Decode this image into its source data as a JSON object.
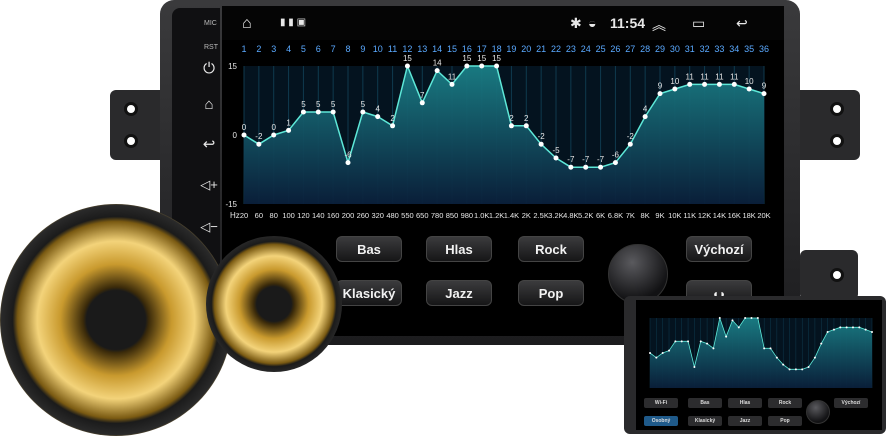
{
  "side_panel": {
    "mic_label": "MIC",
    "rst_label": "RST",
    "icons": [
      "power-icon",
      "home-icon",
      "back-icon",
      "volume-up-icon",
      "volume-down-icon"
    ]
  },
  "status_bar": {
    "time": "11:54",
    "icons": [
      "home-outline-icon",
      "notification-icons",
      "bluetooth-icon",
      "wifi-icon",
      "expand-icon",
      "recent-apps-icon",
      "back-icon"
    ]
  },
  "equalizer": {
    "band_numbers": [
      "1",
      "2",
      "3",
      "4",
      "5",
      "6",
      "7",
      "8",
      "9",
      "10",
      "11",
      "12",
      "13",
      "14",
      "15",
      "16",
      "17",
      "18",
      "19",
      "20",
      "21",
      "22",
      "23",
      "24",
      "25",
      "26",
      "27",
      "28",
      "29",
      "30",
      "31",
      "32",
      "33",
      "34",
      "35",
      "36"
    ],
    "y_ticks": [
      "15",
      "0",
      "-15"
    ],
    "freq_unit": "Hz",
    "freq_labels": [
      "20",
      "60",
      "80",
      "100",
      "120",
      "140",
      "160",
      "200",
      "260",
      "320",
      "480",
      "550",
      "650",
      "780",
      "850",
      "980",
      "1.0K",
      "1.2K",
      "1.4K",
      "2K",
      "2.5K",
      "3.2K",
      "4.8K",
      "5.2K",
      "6K",
      "6.8K",
      "7K",
      "8K",
      "9K",
      "10K",
      "11K",
      "12K",
      "14K",
      "16K",
      "18K",
      "20K"
    ]
  },
  "chart_data": {
    "type": "line",
    "x": [
      "1",
      "2",
      "3",
      "4",
      "5",
      "6",
      "7",
      "8",
      "9",
      "10",
      "11",
      "12",
      "13",
      "14",
      "15",
      "16",
      "17",
      "18",
      "19",
      "20",
      "21",
      "22",
      "23",
      "24",
      "25",
      "26",
      "27",
      "28",
      "29",
      "30",
      "31",
      "32",
      "33",
      "34",
      "35",
      "36"
    ],
    "series": [
      {
        "values": [
          0,
          -2,
          0,
          1,
          5,
          5,
          5,
          -6,
          5,
          4,
          2,
          15,
          7,
          14,
          11,
          15,
          15,
          15,
          2,
          2,
          -2,
          -5,
          -7,
          -7,
          -7,
          -6,
          -2,
          4,
          9,
          10,
          11,
          11,
          11,
          11,
          10,
          9
        ]
      }
    ],
    "ylim": [
      -15,
      15
    ],
    "colors": {
      "line": "#5ee8d8",
      "fill_top": "#1a7f86",
      "fill_bottom": "#0a1f3a"
    }
  },
  "buttons": {
    "row1": [
      "Bas",
      "Hlas",
      "Rock",
      "Výchozí"
    ],
    "row2": [
      "Klasický",
      "Jazz",
      "Pop"
    ]
  },
  "mini_buttons": [
    "Wi-Fi",
    "Bas",
    "Hlas",
    "Rock",
    "Výchozí",
    "Osobný",
    "Klasický",
    "Jazz",
    "Pop"
  ]
}
